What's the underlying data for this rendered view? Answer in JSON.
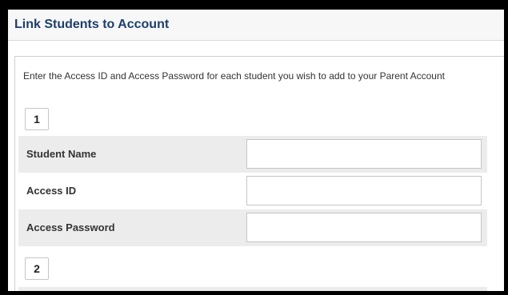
{
  "panel": {
    "title": "Link Students to Account"
  },
  "instructions": "Enter the Access ID and Access Password for each student you wish to add to your Parent Account",
  "students": [
    {
      "number": "1",
      "fields": {
        "student_name": {
          "label": "Student Name",
          "value": ""
        },
        "access_id": {
          "label": "Access ID",
          "value": ""
        },
        "access_password": {
          "label": "Access Password",
          "value": ""
        }
      }
    },
    {
      "number": "2"
    }
  ]
}
